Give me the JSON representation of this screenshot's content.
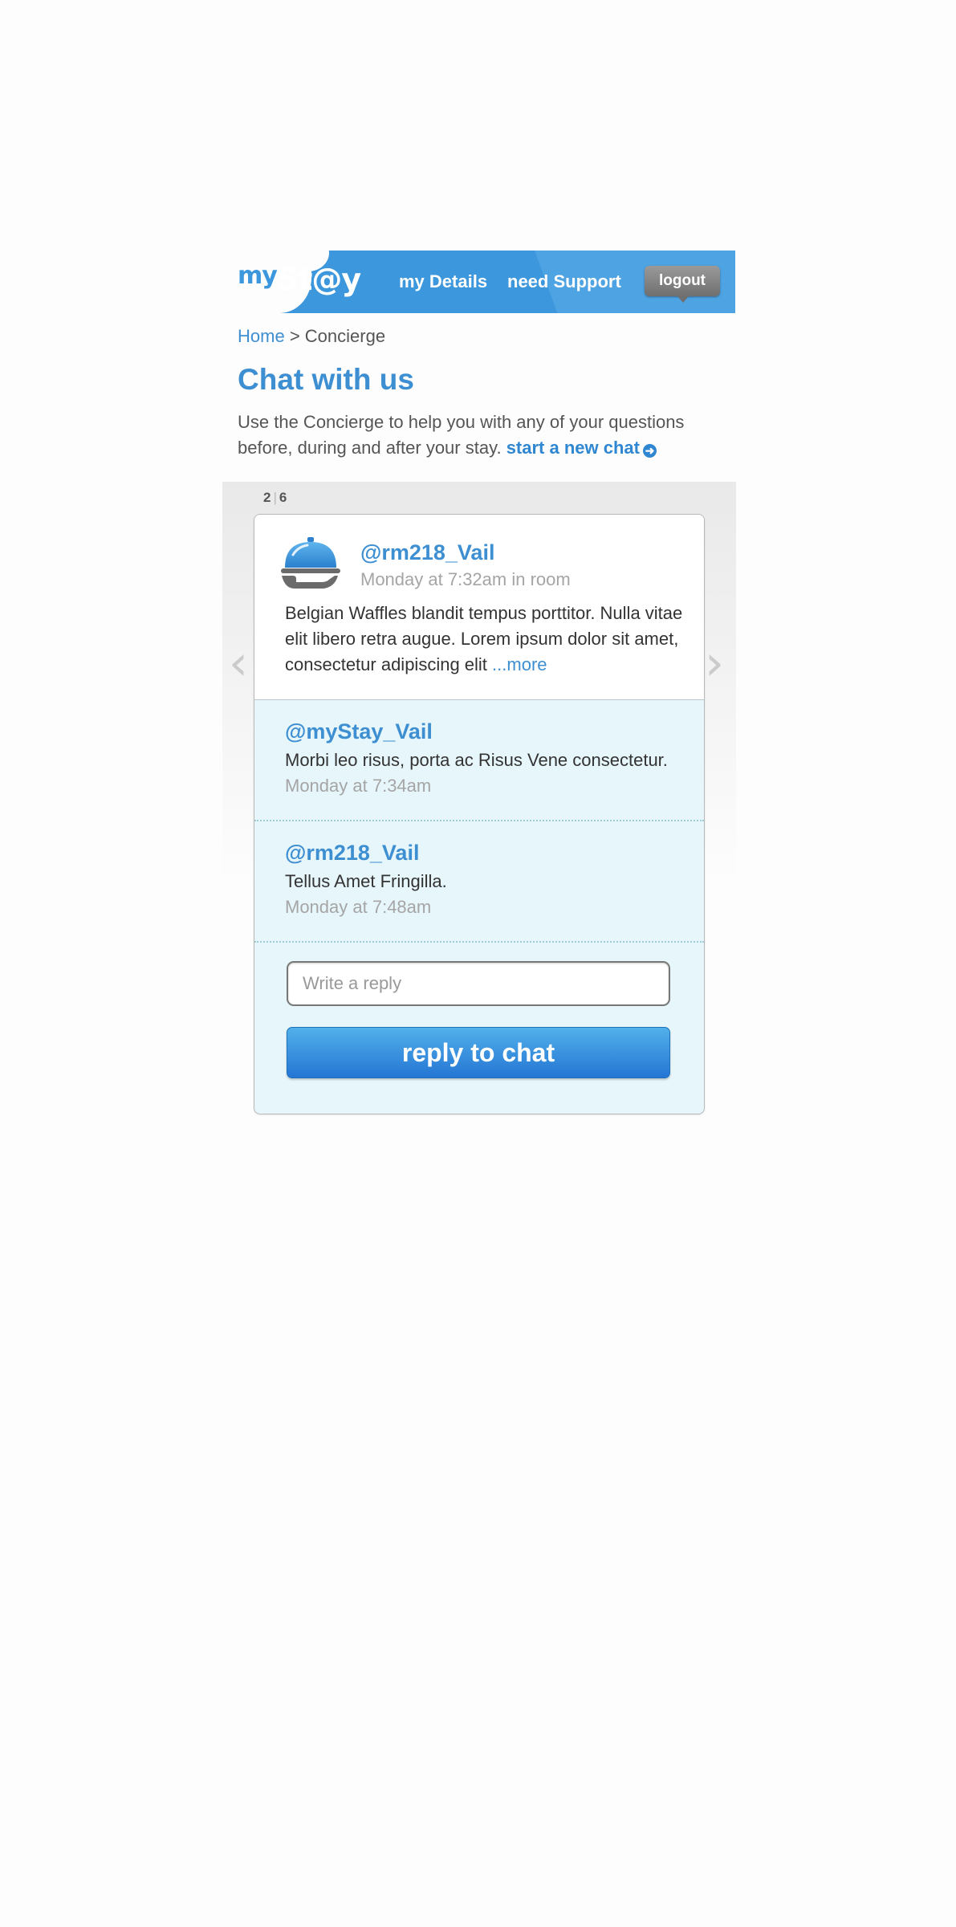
{
  "header": {
    "logo_my": "my",
    "logo_stay": "St@y",
    "nav": [
      "my Details",
      "need Support"
    ],
    "logout_label": "logout"
  },
  "breadcrumb": {
    "home": "Home",
    "separator": ">",
    "current": "Concierge"
  },
  "page": {
    "title": "Chat with us",
    "intro": "Use the Concierge to help you with any of your questions before, during and after your stay.",
    "new_chat_link": "start a new chat"
  },
  "pager": {
    "current": "2",
    "total": "6"
  },
  "chat": {
    "post": {
      "user": "@rm218_Vail",
      "meta": "Monday at 7:32am in room",
      "body": "Belgian Waffles blandit tempus porttitor. Nulla vitae elit libero retra augue. Lorem ipsum dolor sit amet, consectetur adipiscing elit",
      "more": "...more"
    },
    "replies": [
      {
        "user": "@myStay_Vail",
        "text": "Morbi leo risus, porta ac Risus Vene consectetur.",
        "time": "Monday at 7:34am"
      },
      {
        "user": "@rm218_Vail",
        "text": "Tellus Amet Fringilla.",
        "time": "Monday at 7:48am"
      }
    ],
    "reply_placeholder": "Write a reply",
    "reply_button": "reply to chat"
  },
  "icons": {
    "avatar": "service-cloche-icon",
    "new_chat": "circle-arrow-right-icon",
    "prev": "chevron-left-icon",
    "next": "chevron-right-icon"
  },
  "colors": {
    "brand_blue": "#3d97dc",
    "link_blue": "#3d8fd2",
    "chat_bg": "#e6f6fb",
    "logout_gray": "#808080"
  }
}
